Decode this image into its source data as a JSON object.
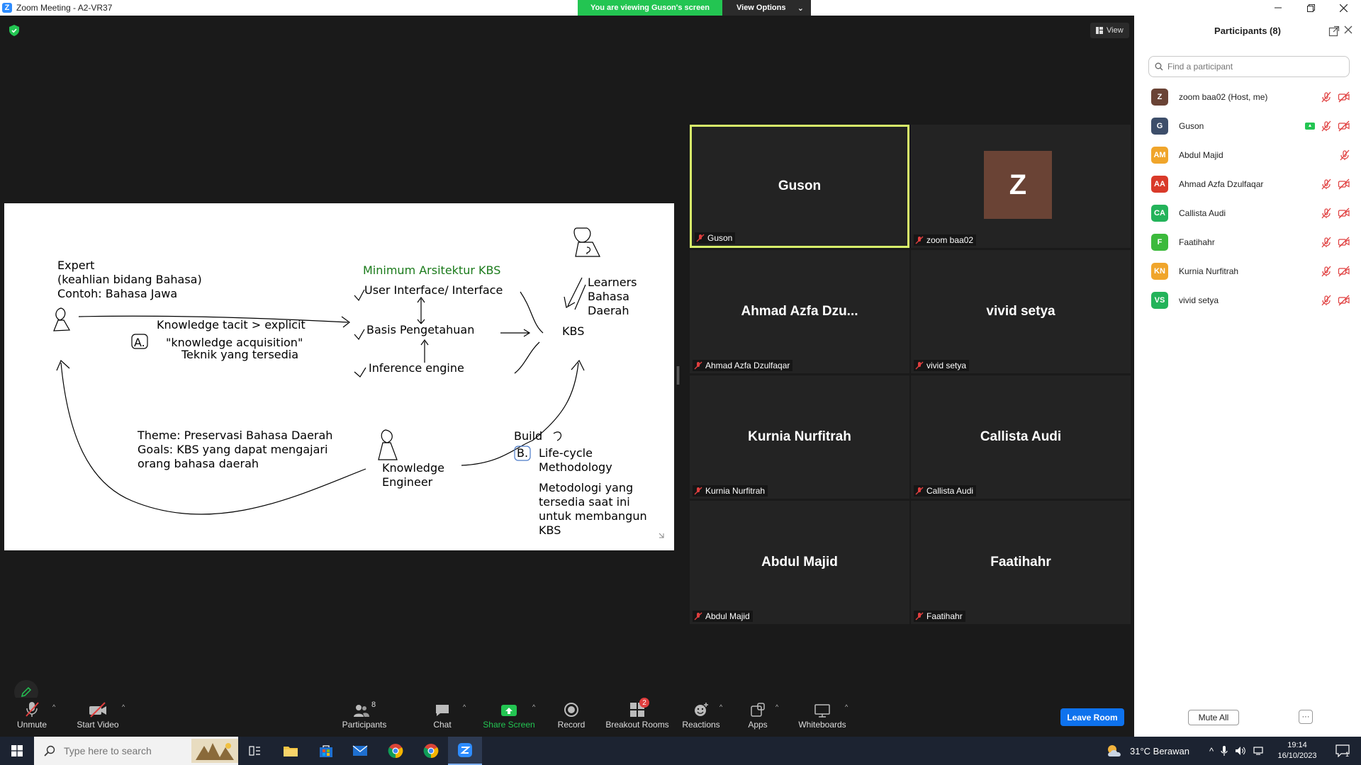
{
  "window": {
    "title": "Zoom Meeting - A2-VR37",
    "logo_letter": "Z"
  },
  "banner": {
    "viewing_text": "You are viewing Guson's screen",
    "view_options_label": "View Options"
  },
  "top_right": {
    "view_label": "View"
  },
  "whiteboard": {
    "expert": [
      "Expert",
      "(keahlian bidang Bahasa)",
      "Contoh: Bahasa Jawa"
    ],
    "knowledge_tacit": "Knowledge tacit > explicit",
    "marker_a": "A.",
    "ka_quote": "\"knowledge acquisition\"",
    "ka_tech": "Teknik yang tersedia",
    "arch_title": "Minimum Arsitektur KBS",
    "ui": "User Interface/ Interface",
    "basis": "Basis Pengetahuan",
    "inference": "Inference engine",
    "kbs": "KBS",
    "learners": [
      "Learners",
      "Bahasa",
      "Daerah"
    ],
    "theme": "Theme: Preservasi Bahasa Daerah",
    "goals_1": "Goals: KBS yang dapat mengajari",
    "goals_2": "orang bahasa daerah",
    "ke": [
      "Knowledge",
      "Engineer"
    ],
    "build": "Build",
    "marker_b": "B.",
    "lifecycle": [
      "Life-cycle",
      "Methodology"
    ],
    "method": [
      "Metodologi yang",
      "tersedia saat ini",
      "untuk membangun",
      "KBS"
    ]
  },
  "tiles": [
    {
      "name": "Guson",
      "label": "Guson",
      "active": true
    },
    {
      "name": "",
      "label": "zoom baa02",
      "avatar_letter": "Z"
    },
    {
      "name": "Ahmad  Azfa  Dzu...",
      "label": "Ahmad Azfa Dzulfaqar"
    },
    {
      "name": "vivid setya",
      "label": "vivid setya"
    },
    {
      "name": "Kurnia Nurfitrah",
      "label": "Kurnia Nurfitrah"
    },
    {
      "name": "Callista Audi",
      "label": "Callista Audi"
    },
    {
      "name": "Abdul Majid",
      "label": "Abdul Majid"
    },
    {
      "name": "Faatihahr",
      "label": "Faatihahr"
    }
  ],
  "participants_panel": {
    "title": "Participants (8)",
    "search_placeholder": "Find a participant",
    "items": [
      {
        "initials": "Z",
        "name": "zoom baa02 (Host, me)",
        "color": "#6a4335"
      },
      {
        "initials": "G",
        "name": "Guson",
        "color": "#3d4e6a",
        "sharing": true
      },
      {
        "initials": "AM",
        "name": "Abdul Majid",
        "color": "#f0a52b"
      },
      {
        "initials": "AA",
        "name": "Ahmad Azfa Dzulfaqar",
        "color": "#d93a2a"
      },
      {
        "initials": "CA",
        "name": "Callista Audi",
        "color": "#23b35a"
      },
      {
        "initials": "F",
        "name": "Faatihahr",
        "color": "#3cba3c"
      },
      {
        "initials": "KN",
        "name": "Kurnia Nurfitrah",
        "color": "#f0a52b"
      },
      {
        "initials": "VS",
        "name": "vivid setya",
        "color": "#23b35a"
      }
    ],
    "mute_all_label": "Mute All",
    "more_label": "···"
  },
  "toolbar": {
    "unmute": "Unmute",
    "start_video": "Start Video",
    "participants": "Participants",
    "participants_count": "8",
    "chat": "Chat",
    "share_screen": "Share Screen",
    "record": "Record",
    "breakout_rooms": "Breakout Rooms",
    "breakout_badge": "2",
    "reactions": "Reactions",
    "apps": "Apps",
    "whiteboards": "Whiteboards",
    "leave_room": "Leave Room"
  },
  "taskbar": {
    "search_placeholder": "Type here to search",
    "weather": "31°C  Berawan",
    "time": "19:14",
    "date": "16/10/2023",
    "notification_count": "1"
  }
}
